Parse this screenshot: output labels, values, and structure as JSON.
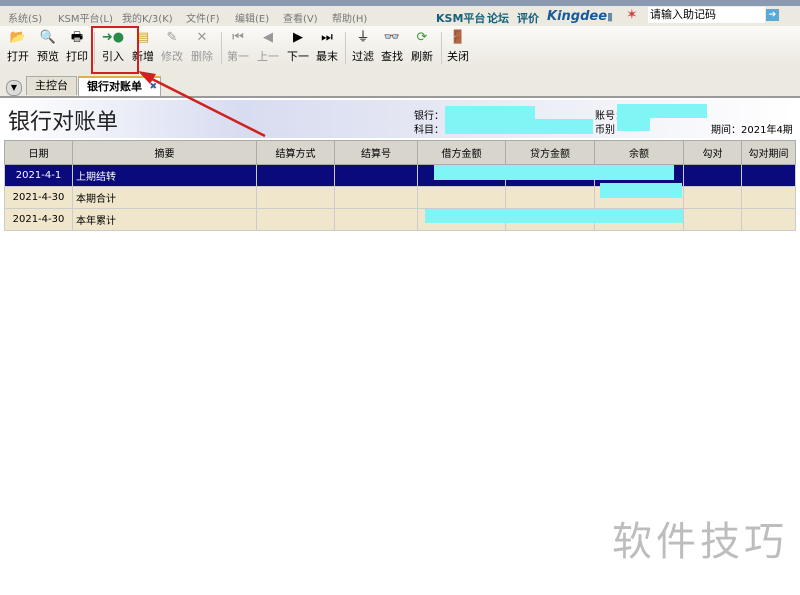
{
  "menu": [
    "系统(S)",
    "KSM平台(L)",
    "我的K/3(K)",
    "文件(F)",
    "编辑(E)",
    "查看(V)",
    "帮助(H)"
  ],
  "brand": {
    "ksm": "KSM平台",
    "forum": "论坛",
    "review": "评价",
    "logo": "Kingdee",
    "help_placeholder": "请输入助记码"
  },
  "toolbar": [
    {
      "label": "打开",
      "icon": "open-folder-icon",
      "enabled": true
    },
    {
      "label": "预览",
      "icon": "preview-icon",
      "enabled": true
    },
    {
      "label": "打印",
      "icon": "printer-icon",
      "enabled": true
    },
    {
      "label": "引入",
      "icon": "import-icon",
      "enabled": true
    },
    {
      "label": "新增",
      "icon": "new-icon",
      "enabled": true
    },
    {
      "label": "修改",
      "icon": "edit-icon",
      "enabled": false
    },
    {
      "label": "删除",
      "icon": "delete-icon",
      "enabled": false
    },
    {
      "label": "第一",
      "icon": "first-icon",
      "enabled": false
    },
    {
      "label": "上一",
      "icon": "prev-icon",
      "enabled": false
    },
    {
      "label": "下一",
      "icon": "next-icon",
      "enabled": true
    },
    {
      "label": "最末",
      "icon": "last-icon",
      "enabled": true
    },
    {
      "label": "过滤",
      "icon": "filter-icon",
      "enabled": true
    },
    {
      "label": "查找",
      "icon": "binoculars-icon",
      "enabled": true
    },
    {
      "label": "刷新",
      "icon": "refresh-icon",
      "enabled": true
    },
    {
      "label": "关闭",
      "icon": "exit-door-icon",
      "enabled": true
    }
  ],
  "tabs": [
    {
      "label": "主控台"
    },
    {
      "label": "银行对账单",
      "active": true
    }
  ],
  "page": {
    "title": "银行对账单",
    "bank_label": "银行：",
    "subject_label": "科目：",
    "account_label": "账号：",
    "currency_label": "币别",
    "period": "期间：2021年4期"
  },
  "table": {
    "columns": [
      "日期",
      "摘要",
      "结算方式",
      "结算号",
      "借方金额",
      "贷方金额",
      "余额",
      "勾对",
      "勾对期间"
    ],
    "rows": [
      {
        "date": "2021-4-1",
        "summary": "上期结转",
        "selected": true
      },
      {
        "date": "2021-4-30",
        "summary": "本期合计"
      },
      {
        "date": "2021-4-30",
        "summary": "本年累计"
      }
    ]
  },
  "watermark": "软件技巧"
}
